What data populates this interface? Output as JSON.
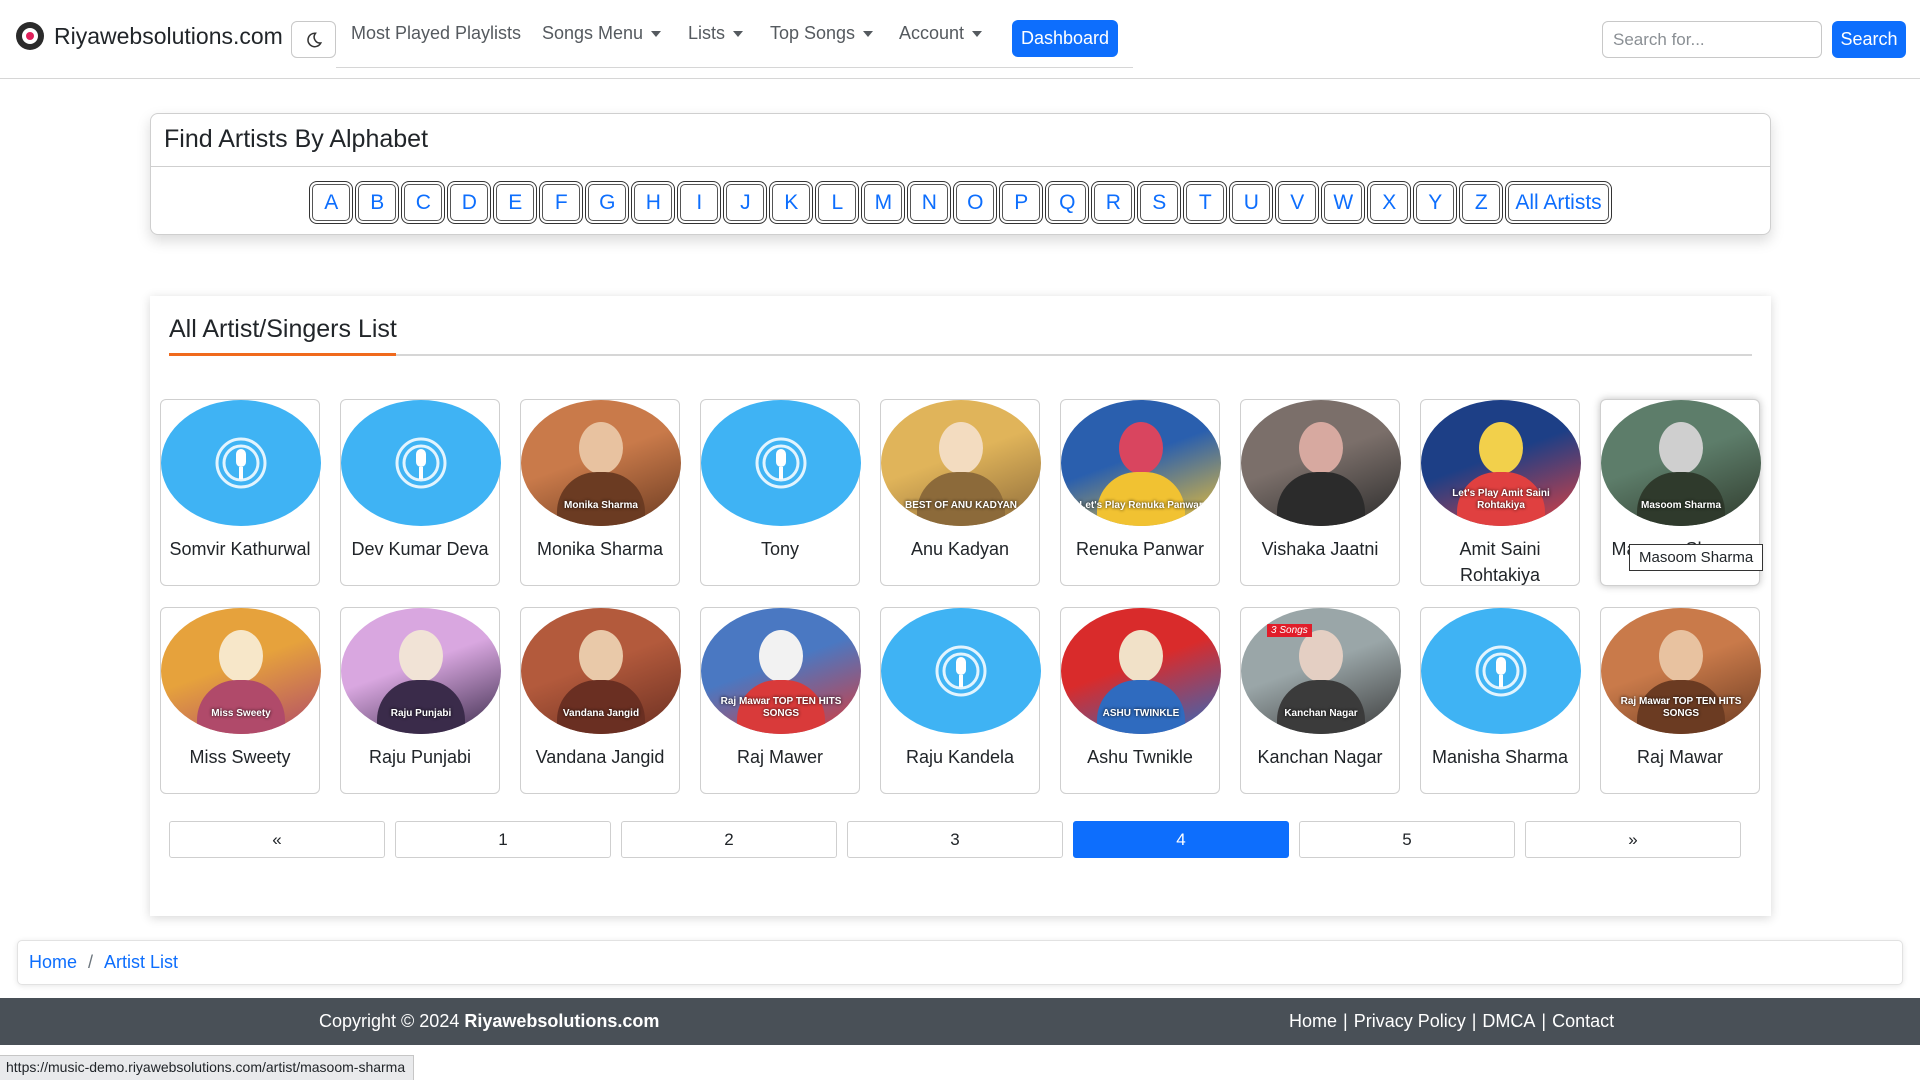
{
  "navbar": {
    "brand": "Riyawebsolutions.com",
    "menu": [
      {
        "label": "Most Played Playlists",
        "dropdown": false
      },
      {
        "label": "Songs Menu",
        "dropdown": true
      },
      {
        "label": "Lists",
        "dropdown": true
      },
      {
        "label": "Top Songs",
        "dropdown": true
      },
      {
        "label": "Account",
        "dropdown": true
      }
    ],
    "dashboard_label": "Dashboard",
    "search_placeholder": "Search for...",
    "search_label": "Search"
  },
  "alphabet": {
    "title": "Find Artists By Alphabet",
    "letters": [
      "A",
      "B",
      "C",
      "D",
      "E",
      "F",
      "G",
      "H",
      "I",
      "J",
      "K",
      "L",
      "M",
      "N",
      "O",
      "P",
      "Q",
      "R",
      "S",
      "T",
      "U",
      "V",
      "W",
      "X",
      "Y",
      "Z"
    ],
    "all_label": "All Artists"
  },
  "artists": {
    "title": "All Artist/Singers List",
    "rows": [
      [
        {
          "name": "Somvir Kathurwal",
          "image": "placeholder"
        },
        {
          "name": "Dev Kumar Deva",
          "image": "placeholder"
        },
        {
          "name": "Monika Sharma",
          "image": "photo",
          "caption": "Monika Sharma"
        },
        {
          "name": "Tony",
          "image": "placeholder"
        },
        {
          "name": "Anu Kadyan",
          "image": "photo",
          "caption": "BEST OF ANU KADYAN"
        },
        {
          "name": "Renuka Panwar",
          "image": "photo",
          "caption": "Let's Play Renuka Panwar"
        },
        {
          "name": "Vishaka Jaatni",
          "image": "photo"
        },
        {
          "name": "Amit Saini Rohtakiya",
          "image": "photo",
          "caption": "Let's Play Amit Saini Rohtakiya"
        },
        {
          "name": "Masoom Sharma",
          "image": "photo",
          "caption": "Masoom Sharma",
          "tooltip": "Masoom Sharma"
        }
      ],
      [
        {
          "name": "Miss Sweety",
          "image": "photo",
          "caption": "Miss Sweety"
        },
        {
          "name": "Raju Punjabi",
          "image": "photo",
          "caption": "Raju Punjabi"
        },
        {
          "name": "Vandana Jangid",
          "image": "photo",
          "caption": "Vandana Jangid"
        },
        {
          "name": "Raj Mawer",
          "image": "photo",
          "caption": "Raj Mawar TOP TEN HITS SONGS"
        },
        {
          "name": "Raju Kandela",
          "image": "placeholder"
        },
        {
          "name": "Ashu Twnikle",
          "image": "photo",
          "caption": "ASHU TWINKLE"
        },
        {
          "name": "Kanchan Nagar",
          "image": "photo",
          "caption": "Kanchan Nagar",
          "badge": "3 Songs"
        },
        {
          "name": "Manisha Sharma",
          "image": "placeholder"
        },
        {
          "name": "Raj Mawar",
          "image": "photo",
          "caption": "Raj Mawar TOP TEN HITS SONGS"
        }
      ]
    ]
  },
  "pagination": {
    "pages": [
      "«",
      "1",
      "2",
      "3",
      "4",
      "5",
      "»"
    ],
    "active": "4"
  },
  "breadcrumb": {
    "items": [
      "Home",
      "Artist List"
    ]
  },
  "footer": {
    "copyright_prefix": "Copyright © 2024",
    "copyright_site": "Riyawebsolutions.com",
    "links": [
      "Home",
      "Privacy Policy",
      "DMCA",
      "Contact"
    ]
  },
  "status_url": "https://music-demo.riyawebsolutions.com/artist/masoom-sharma",
  "colors": {
    "primary": "#0d6efd",
    "accent_underline": "#f06a1d",
    "placeholder_bg": "#3fb3f4",
    "footer_bg": "#495057"
  }
}
